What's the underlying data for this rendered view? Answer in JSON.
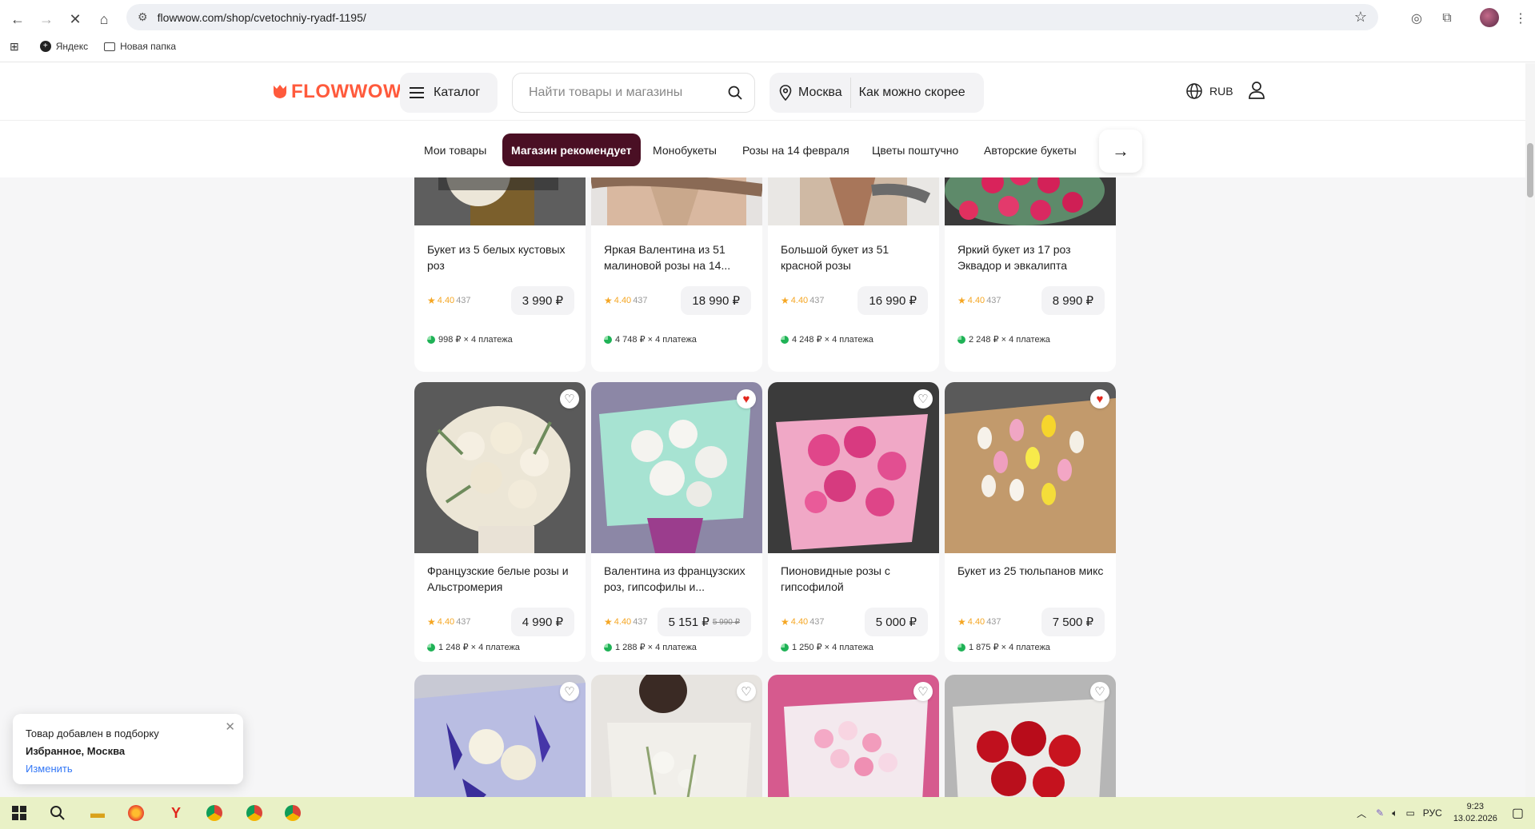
{
  "browser": {
    "url": "flowwow.com/shop/cvetochniy-ryadf-1195/",
    "bookmarks": [
      {
        "label": "Яндекс"
      },
      {
        "label": "Новая папка"
      }
    ]
  },
  "header": {
    "logo_text": "FLOWWOW",
    "catalog_label": "Каталог",
    "search_placeholder": "Найти товары и магазины",
    "city": "Москва",
    "delivery_time": "Как можно скорее",
    "currency": "RUB",
    "brand_color": "#ff5a3c"
  },
  "tabs": [
    {
      "label": "Мои товары",
      "active": false
    },
    {
      "label": "Магазин рекомендует",
      "active": true
    },
    {
      "label": "Монобукеты",
      "active": false
    },
    {
      "label": "Розы на 14 февраля",
      "active": false
    },
    {
      "label": "Цветы поштучно",
      "active": false
    },
    {
      "label": "Авторские букеты",
      "active": false
    }
  ],
  "active_tab_color": "#4a0f24",
  "products": [
    {
      "title": "Букет из 5 белых кустовых роз",
      "rating": "4.40",
      "reviews": "437",
      "price": "3 990 ₽",
      "old_price": "",
      "installment": "998 ₽ × 4 платежа",
      "favorite": false,
      "image": "white-roses"
    },
    {
      "title": "Яркая Валентина из 51 малиновой розы на 14...",
      "rating": "4.40",
      "reviews": "437",
      "price": "18 990 ₽",
      "old_price": "",
      "installment": "4 748 ₽ × 4 платежа",
      "favorite": false,
      "image": "pink-roses"
    },
    {
      "title": "Большой букет из 51 красной розы",
      "rating": "4.40",
      "reviews": "437",
      "price": "16 990 ₽",
      "old_price": "",
      "installment": "4 248 ₽ × 4 платежа",
      "favorite": false,
      "image": "red-roses"
    },
    {
      "title": "Яркий букет из 17 роз Эквадор и эвкалипта",
      "rating": "4.40",
      "reviews": "437",
      "price": "8 990 ₽",
      "old_price": "",
      "installment": "2 248 ₽ × 4 платежа",
      "favorite": false,
      "image": "red-eucalyptus"
    },
    {
      "title": "Французские белые розы и Альстромерия",
      "rating": "4.40",
      "reviews": "437",
      "price": "4 990 ₽",
      "old_price": "",
      "installment": "1 248 ₽ × 4 платежа",
      "favorite": false,
      "image": "french-white"
    },
    {
      "title": "Валентина из французских роз, гипсофилы и...",
      "rating": "4.40",
      "reviews": "437",
      "price": "5 151 ₽",
      "old_price": "5 990 ₽",
      "installment": "1 288 ₽ × 4 платежа",
      "favorite": true,
      "image": "white-mint"
    },
    {
      "title": "Пионовидные розы с гипсофилой",
      "rating": "4.40",
      "reviews": "437",
      "price": "5 000 ₽",
      "old_price": "",
      "installment": "1 250 ₽ × 4 платежа",
      "favorite": false,
      "image": "peony-pink"
    },
    {
      "title": "Букет из 25 тюльпанов микс",
      "rating": "4.40",
      "reviews": "437",
      "price": "7 500 ₽",
      "old_price": "",
      "installment": "1 875 ₽ × 4 платежа",
      "favorite": true,
      "image": "tulips"
    },
    {
      "title": "",
      "rating": "",
      "reviews": "",
      "price": "",
      "old_price": "",
      "installment": "",
      "favorite": false,
      "image": "iris"
    },
    {
      "title": "",
      "rating": "",
      "reviews": "",
      "price": "",
      "old_price": "",
      "installment": "",
      "favorite": false,
      "image": "white-bouquet"
    },
    {
      "title": "",
      "rating": "",
      "reviews": "",
      "price": "",
      "old_price": "",
      "installment": "",
      "favorite": false,
      "image": "spray-roses"
    },
    {
      "title": "",
      "rating": "",
      "reviews": "",
      "price": "",
      "old_price": "",
      "installment": "",
      "favorite": false,
      "image": "red-bouquet"
    }
  ],
  "toast": {
    "line1": "Товар добавлен в подборку",
    "line2": "Избранное, Москва",
    "action": "Изменить"
  },
  "taskbar": {
    "lang": "РУС",
    "time": "9:23",
    "date": "13.02.2026"
  }
}
